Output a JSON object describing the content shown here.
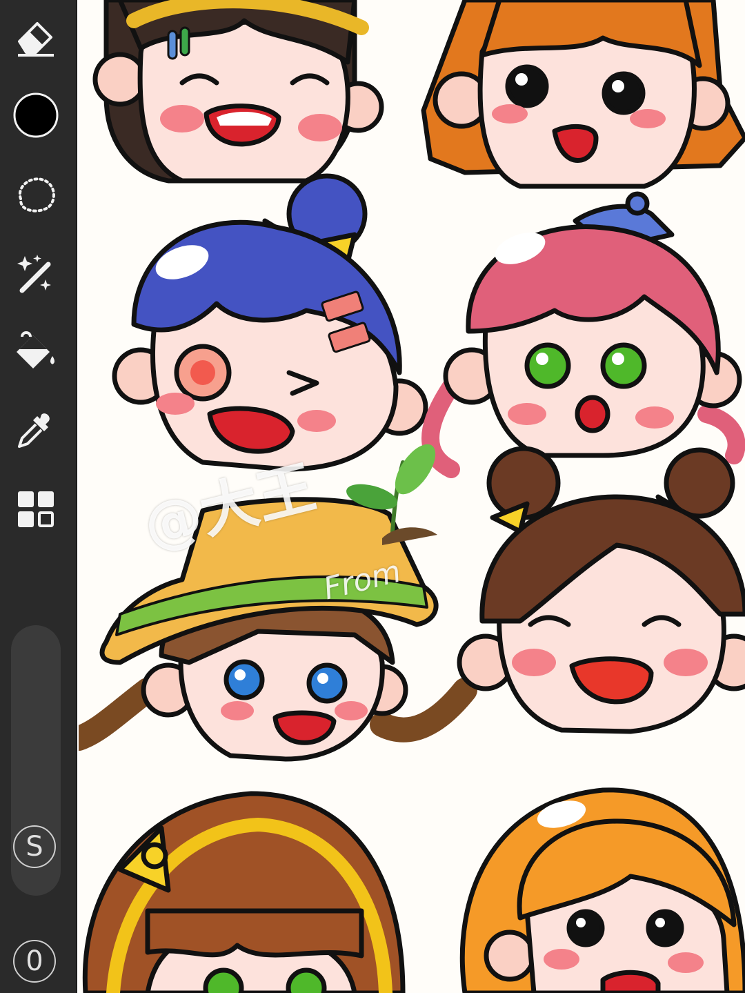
{
  "toolbar": {
    "tools": [
      "eraser-icon",
      "color-swatch",
      "lasso-select-icon",
      "magic-wand-icon",
      "paint-bucket-icon",
      "eyedropper-icon",
      "layers-grid-icon"
    ],
    "current_color": "#000000",
    "symmetry_label": "S",
    "zoom_label": "0"
  },
  "canvas": {
    "watermark": "@大王",
    "watermark_sub": "From"
  },
  "colors": {
    "toolbar_bg": "#2a2a2a",
    "skin": "#fde2dc",
    "blush": "#f4828a",
    "mouth": "#d9232d"
  }
}
